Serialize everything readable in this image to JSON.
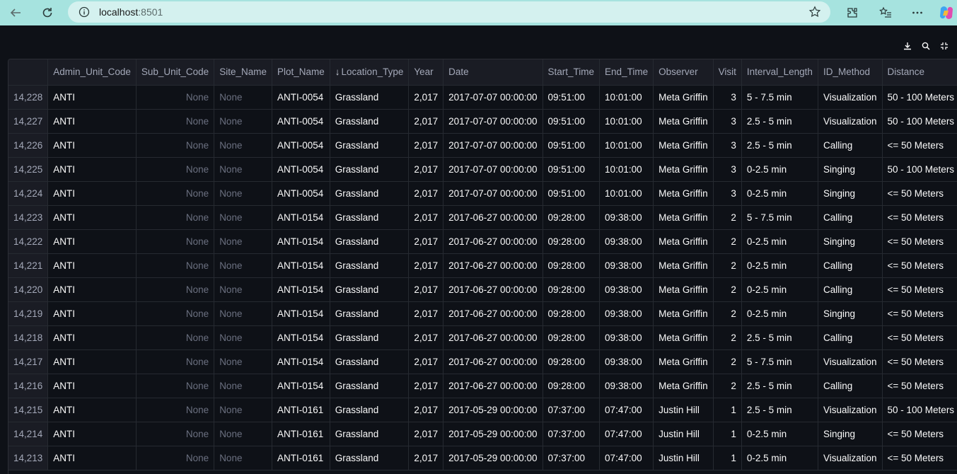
{
  "browser": {
    "url_host": "localhost",
    "url_port": ":8501"
  },
  "toolbar": {
    "icons": [
      "download-icon",
      "search-icon",
      "fullscreen-icon"
    ]
  },
  "table": {
    "sort_arrow": "↓",
    "columns": [
      "",
      "Admin_Unit_Code",
      "Sub_Unit_Code",
      "Site_Name",
      "Plot_Name",
      "Location_Type",
      "Year",
      "Date",
      "Start_Time",
      "End_Time",
      "Observer",
      "Visit",
      "Interval_Length",
      "ID_Method",
      "Distance"
    ],
    "sorted_column": "Location_Type",
    "rows": [
      [
        "14,228",
        "ANTI",
        "None",
        "None",
        "ANTI-0054",
        "Grassland",
        "2,017",
        "2017-07-07 00:00:00",
        "09:51:00",
        "10:01:00",
        "Meta Griffin",
        "3",
        "5 - 7.5 min",
        "Visualization",
        "50 - 100 Meters"
      ],
      [
        "14,227",
        "ANTI",
        "None",
        "None",
        "ANTI-0054",
        "Grassland",
        "2,017",
        "2017-07-07 00:00:00",
        "09:51:00",
        "10:01:00",
        "Meta Griffin",
        "3",
        "2.5 - 5 min",
        "Visualization",
        "50 - 100 Meters"
      ],
      [
        "14,226",
        "ANTI",
        "None",
        "None",
        "ANTI-0054",
        "Grassland",
        "2,017",
        "2017-07-07 00:00:00",
        "09:51:00",
        "10:01:00",
        "Meta Griffin",
        "3",
        "2.5 - 5 min",
        "Calling",
        "<= 50 Meters"
      ],
      [
        "14,225",
        "ANTI",
        "None",
        "None",
        "ANTI-0054",
        "Grassland",
        "2,017",
        "2017-07-07 00:00:00",
        "09:51:00",
        "10:01:00",
        "Meta Griffin",
        "3",
        "0-2.5 min",
        "Singing",
        "50 - 100 Meters"
      ],
      [
        "14,224",
        "ANTI",
        "None",
        "None",
        "ANTI-0054",
        "Grassland",
        "2,017",
        "2017-07-07 00:00:00",
        "09:51:00",
        "10:01:00",
        "Meta Griffin",
        "3",
        "0-2.5 min",
        "Singing",
        "<= 50 Meters"
      ],
      [
        "14,223",
        "ANTI",
        "None",
        "None",
        "ANTI-0154",
        "Grassland",
        "2,017",
        "2017-06-27 00:00:00",
        "09:28:00",
        "09:38:00",
        "Meta Griffin",
        "2",
        "5 - 7.5 min",
        "Calling",
        "<= 50 Meters"
      ],
      [
        "14,222",
        "ANTI",
        "None",
        "None",
        "ANTI-0154",
        "Grassland",
        "2,017",
        "2017-06-27 00:00:00",
        "09:28:00",
        "09:38:00",
        "Meta Griffin",
        "2",
        "0-2.5 min",
        "Singing",
        "<= 50 Meters"
      ],
      [
        "14,221",
        "ANTI",
        "None",
        "None",
        "ANTI-0154",
        "Grassland",
        "2,017",
        "2017-06-27 00:00:00",
        "09:28:00",
        "09:38:00",
        "Meta Griffin",
        "2",
        "0-2.5 min",
        "Calling",
        "<= 50 Meters"
      ],
      [
        "14,220",
        "ANTI",
        "None",
        "None",
        "ANTI-0154",
        "Grassland",
        "2,017",
        "2017-06-27 00:00:00",
        "09:28:00",
        "09:38:00",
        "Meta Griffin",
        "2",
        "0-2.5 min",
        "Calling",
        "<= 50 Meters"
      ],
      [
        "14,219",
        "ANTI",
        "None",
        "None",
        "ANTI-0154",
        "Grassland",
        "2,017",
        "2017-06-27 00:00:00",
        "09:28:00",
        "09:38:00",
        "Meta Griffin",
        "2",
        "0-2.5 min",
        "Singing",
        "<= 50 Meters"
      ],
      [
        "14,218",
        "ANTI",
        "None",
        "None",
        "ANTI-0154",
        "Grassland",
        "2,017",
        "2017-06-27 00:00:00",
        "09:28:00",
        "09:38:00",
        "Meta Griffin",
        "2",
        "2.5 - 5 min",
        "Calling",
        "<= 50 Meters"
      ],
      [
        "14,217",
        "ANTI",
        "None",
        "None",
        "ANTI-0154",
        "Grassland",
        "2,017",
        "2017-06-27 00:00:00",
        "09:28:00",
        "09:38:00",
        "Meta Griffin",
        "2",
        "5 - 7.5 min",
        "Visualization",
        "<= 50 Meters"
      ],
      [
        "14,216",
        "ANTI",
        "None",
        "None",
        "ANTI-0154",
        "Grassland",
        "2,017",
        "2017-06-27 00:00:00",
        "09:28:00",
        "09:38:00",
        "Meta Griffin",
        "2",
        "2.5 - 5 min",
        "Calling",
        "<= 50 Meters"
      ],
      [
        "14,215",
        "ANTI",
        "None",
        "None",
        "ANTI-0161",
        "Grassland",
        "2,017",
        "2017-05-29 00:00:00",
        "07:37:00",
        "07:47:00",
        "Justin Hill",
        "1",
        "2.5 - 5 min",
        "Visualization",
        "50 - 100 Meters"
      ],
      [
        "14,214",
        "ANTI",
        "None",
        "None",
        "ANTI-0161",
        "Grassland",
        "2,017",
        "2017-05-29 00:00:00",
        "07:37:00",
        "07:47:00",
        "Justin Hill",
        "1",
        "0-2.5 min",
        "Singing",
        "<= 50 Meters"
      ],
      [
        "14,213",
        "ANTI",
        "None",
        "None",
        "ANTI-0161",
        "Grassland",
        "2,017",
        "2017-05-29 00:00:00",
        "07:37:00",
        "07:47:00",
        "Justin Hill",
        "1",
        "0-2.5 min",
        "Visualization",
        "<= 50 Meters"
      ]
    ]
  }
}
